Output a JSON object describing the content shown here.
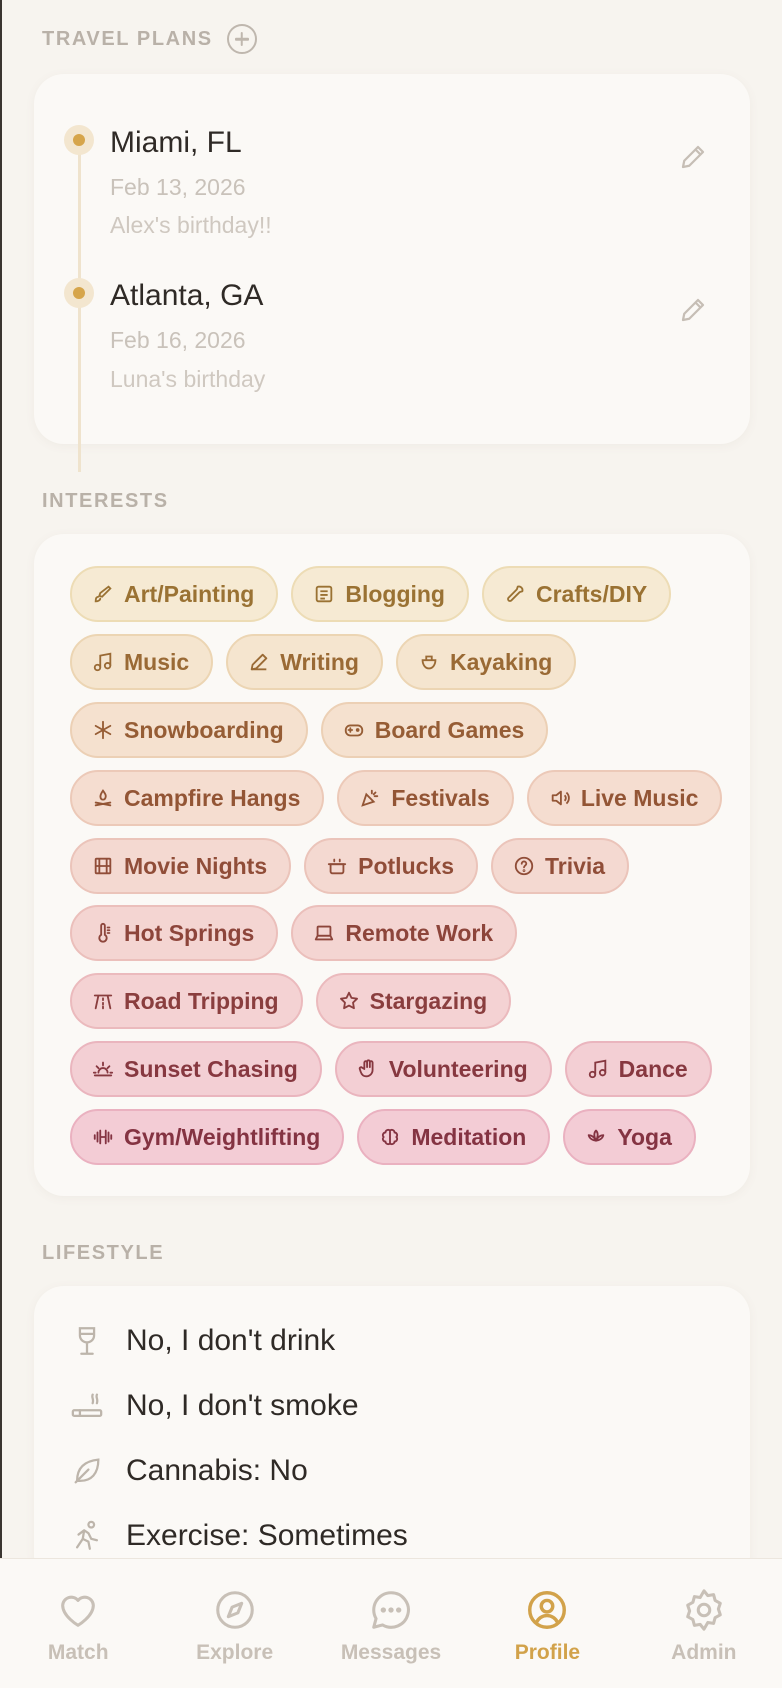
{
  "travel": {
    "header": "TRAVEL PLANS",
    "trips": [
      {
        "city": "Miami, FL",
        "date": "Feb 13, 2026",
        "note": "Alex's birthday!!"
      },
      {
        "city": "Atlanta, GA",
        "date": "Feb 16, 2026",
        "note": "Luna's birthday"
      }
    ]
  },
  "interests": {
    "header": "INTERESTS",
    "chips": [
      {
        "label": "Art/Painting",
        "icon": "brush-icon"
      },
      {
        "label": "Blogging",
        "icon": "newspaper-icon"
      },
      {
        "label": "Crafts/DIY",
        "icon": "wrench-icon"
      },
      {
        "label": "Music",
        "icon": "music-note-icon"
      },
      {
        "label": "Writing",
        "icon": "pencil-icon"
      },
      {
        "label": "Kayaking",
        "icon": "kayak-icon"
      },
      {
        "label": "Snowboarding",
        "icon": "snowflake-icon"
      },
      {
        "label": "Board Games",
        "icon": "gamepad-icon"
      },
      {
        "label": "Campfire Hangs",
        "icon": "campfire-icon"
      },
      {
        "label": "Festivals",
        "icon": "party-popper-icon"
      },
      {
        "label": "Live Music",
        "icon": "speaker-icon"
      },
      {
        "label": "Movie Nights",
        "icon": "film-icon"
      },
      {
        "label": "Potlucks",
        "icon": "cooking-pot-icon"
      },
      {
        "label": "Trivia",
        "icon": "question-circle-icon"
      },
      {
        "label": "Hot Springs",
        "icon": "thermometer-icon"
      },
      {
        "label": "Remote Work",
        "icon": "laptop-icon"
      },
      {
        "label": "Road Tripping",
        "icon": "road-icon"
      },
      {
        "label": "Stargazing",
        "icon": "star-icon"
      },
      {
        "label": "Sunset Chasing",
        "icon": "sunset-icon"
      },
      {
        "label": "Volunteering",
        "icon": "hand-icon"
      },
      {
        "label": "Dance",
        "icon": "music-note-icon"
      },
      {
        "label": "Gym/Weightlifting",
        "icon": "dumbbell-icon"
      },
      {
        "label": "Meditation",
        "icon": "brain-icon"
      },
      {
        "label": "Yoga",
        "icon": "lotus-icon"
      }
    ]
  },
  "lifestyle": {
    "header": "LIFESTYLE",
    "items": [
      {
        "label": "No, I don't drink",
        "icon": "wine-glass-icon"
      },
      {
        "label": "No, I don't smoke",
        "icon": "cigarette-icon"
      },
      {
        "label": "Cannabis: No",
        "icon": "leaf-icon"
      },
      {
        "label": "Exercise: Sometimes",
        "icon": "running-person-icon"
      }
    ]
  },
  "nav": {
    "items": [
      {
        "label": "Match",
        "icon": "heart-icon"
      },
      {
        "label": "Explore",
        "icon": "compass-icon"
      },
      {
        "label": "Messages",
        "icon": "chat-bubble-icon"
      },
      {
        "label": "Profile",
        "icon": "user-circle-icon"
      },
      {
        "label": "Admin",
        "icon": "gear-icon"
      }
    ],
    "active": "Profile"
  },
  "colors": {
    "accent": "#d2a24a",
    "background": "#f7f4ef",
    "card": "#fbf9f6"
  }
}
